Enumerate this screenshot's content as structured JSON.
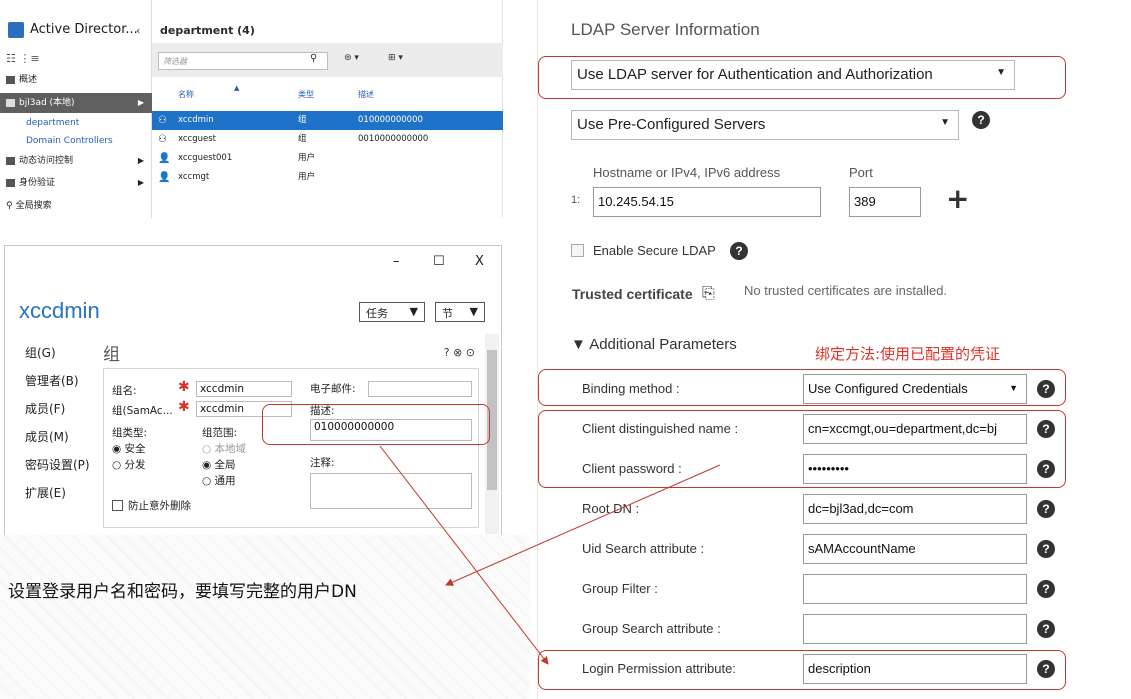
{
  "adac": {
    "app_title": "Active Director...",
    "collapse": "‹",
    "view_icons": "☷  ⋮≡",
    "nav": [
      {
        "label": "概述",
        "type": "top"
      },
      {
        "label": "bjl3ad (本地)",
        "type": "selected"
      },
      {
        "label": "department",
        "type": "child"
      },
      {
        "label": "Domain Controllers",
        "type": "child"
      },
      {
        "label": "动态访问控制",
        "type": "folder"
      },
      {
        "label": "身份验证",
        "type": "folder"
      },
      {
        "label": "全局搜索",
        "type": "search"
      }
    ],
    "list_title": "department  (4)",
    "filter_placeholder": "筛选器",
    "columns": [
      "名称",
      "类型",
      "描述"
    ],
    "rows": [
      {
        "name": "xccdmin",
        "type": "组",
        "desc": "010000000000",
        "selected": true
      },
      {
        "name": "xccguest",
        "type": "组",
        "desc": "0010000000000",
        "selected": false
      },
      {
        "name": "xccguest001",
        "type": "用户",
        "desc": "",
        "selected": false
      },
      {
        "name": "xccmgt",
        "type": "用户",
        "desc": "",
        "selected": false
      }
    ]
  },
  "dialog": {
    "title": "xccdmin",
    "minimize": "–",
    "maximize": "☐",
    "close": "X",
    "tasks_label": "任务",
    "sections_label": "节",
    "nav": [
      "组(G)",
      "管理者(B)",
      "成员(F)",
      "成员(M)",
      "密码设置(P)",
      "扩展(E)"
    ],
    "section_title": "组",
    "section_buttons": "? ⊗ ⊙",
    "group_name_label": "组名:",
    "group_name_value": "xccdmin",
    "sam_label": "组(SamAc...",
    "sam_value": "xccdmin",
    "email_label": "电子邮件:",
    "desc_label": "描述:",
    "desc_value": "010000000000",
    "group_type_label": "组类型:",
    "group_type_options": [
      "安全",
      "分发"
    ],
    "scope_label": "组范围:",
    "scope_options": [
      "本地域",
      "全局",
      "通用"
    ],
    "notes_label": "注释:",
    "protect_label": "防止意外删除"
  },
  "ldap": {
    "header": "LDAP Server Information",
    "usage_select": "Use LDAP server for Authentication and Authorization",
    "server_select": "Use Pre-Configured Servers",
    "hostname_label": "Hostname or IPv4, IPv6 address",
    "port_label": "Port",
    "row_index": "1:",
    "hostname_value": "10.245.54.15",
    "port_value": "389",
    "secure_label": "Enable Secure LDAP",
    "trusted_cert_label": "Trusted certificate",
    "trusted_cert_status": "No trusted certificates are installed.",
    "additional_params": "Additional Parameters",
    "fields": [
      {
        "label": "Binding method :",
        "value": "Use Configured Credentials",
        "kind": "select"
      },
      {
        "label": "Client distinguished name :",
        "value": "cn=xccmgt,ou=department,dc=bj",
        "kind": "input"
      },
      {
        "label": "Client password :",
        "value": "•••••••••",
        "kind": "input"
      },
      {
        "label": "Root DN :",
        "value": "dc=bjl3ad,dc=com",
        "kind": "input"
      },
      {
        "label": "Uid Search attribute :",
        "value": "sAMAccountName",
        "kind": "input"
      },
      {
        "label": "Group Filter :",
        "value": "",
        "kind": "input"
      },
      {
        "label": "Group Search attribute :",
        "value": "",
        "kind": "input"
      },
      {
        "label": "Login Permission attribute:",
        "value": "description",
        "kind": "input"
      }
    ]
  },
  "annotations": {
    "binding_note": "绑定方法:使用已配置的凭证",
    "credential_note": "设置登录用户名和密码，要填写完整的用户DN"
  },
  "colors": {
    "accent_blue": "#1e72c7",
    "callout_red": "#c0392b",
    "note_red": "#e0332a"
  }
}
